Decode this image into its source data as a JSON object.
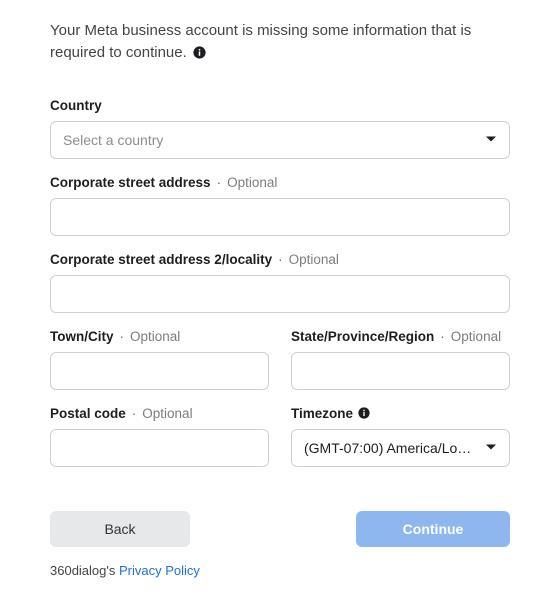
{
  "intro": {
    "text": "Your Meta business account is missing some information that is required to continue."
  },
  "fields": {
    "country": {
      "label": "Country",
      "placeholder": "Select a country"
    },
    "street1": {
      "label": "Corporate street address",
      "optional": "Optional"
    },
    "street2": {
      "label": "Corporate street address 2/locality",
      "optional": "Optional"
    },
    "city": {
      "label": "Town/City",
      "optional": "Optional"
    },
    "state": {
      "label": "State/Province/Region",
      "optional": "Optional"
    },
    "postal": {
      "label": "Postal code",
      "optional": "Optional"
    },
    "timezone": {
      "label": "Timezone",
      "value": "(GMT-07:00) America/Lo…"
    }
  },
  "buttons": {
    "back": "Back",
    "continue": "Continue"
  },
  "footer": {
    "prefix": "360dialog's ",
    "link": "Privacy Policy"
  }
}
